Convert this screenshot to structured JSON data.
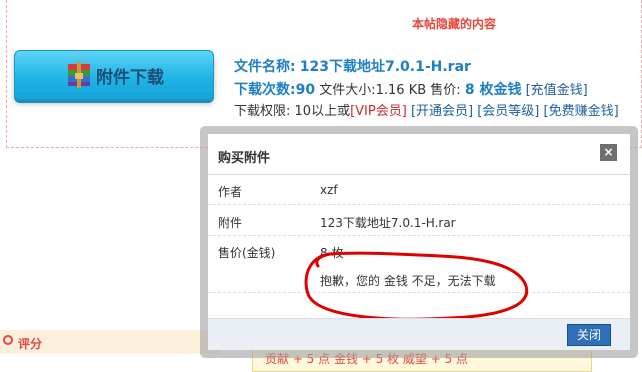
{
  "hidden_section": {
    "title": "本帖隐藏的内容"
  },
  "attachment": {
    "button_label": "附件下载",
    "icon": "rar-archive-icon",
    "name_label": "文件名称:",
    "name_value": "123下载地址7.0.1-H.rar",
    "downloads_label": "下载次数:",
    "downloads_value": "90",
    "size_label": "文件大小:",
    "size_value": "1.16 KB",
    "price_label": "售价:",
    "price_value": "8 枚金钱",
    "recharge_link": "[充值金钱]",
    "permission_label": "下载权限:",
    "permission_value": "10以上或",
    "vip_text": "[VIP会员]",
    "links": [
      "[开通会员]",
      "[会员等级]",
      "[免费赚金钱]"
    ]
  },
  "dialog": {
    "title": "购买附件",
    "close_symbol": "×",
    "rows": [
      {
        "label": "作者",
        "value": "xzf"
      },
      {
        "label": "附件",
        "value": "123下载地址7.0.1-H.rar"
      },
      {
        "label": "售价(金钱)",
        "value": "8 枚"
      }
    ],
    "message": "抱歉，您的 金钱 不足，无法下载",
    "close_button": "关闭"
  },
  "rating": {
    "label": "评分"
  },
  "reward": {
    "text": "贡献 + 5 点 金钱 + 5 枚 威望 + 5 点"
  },
  "colors": {
    "accent_blue": "#1e7fc4",
    "alert_red": "#e8473b",
    "button_blue": "#21b5e6"
  }
}
